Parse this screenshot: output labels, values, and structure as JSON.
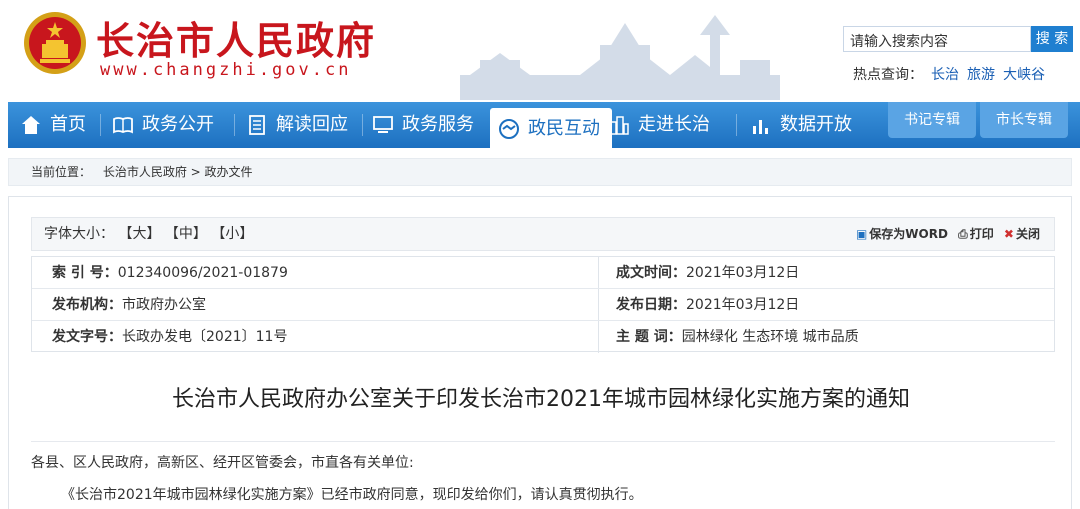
{
  "header": {
    "title": "长治市人民政府",
    "url": "www.changzhi.gov.cn",
    "search_placeholder": "请输入搜索内容",
    "search_button": "搜 索",
    "hot_label": "热点查询：",
    "hot_links": [
      "长治",
      "旅游",
      "大峡谷"
    ]
  },
  "nav": {
    "items": [
      {
        "label": "首页",
        "icon": "home-icon"
      },
      {
        "label": "政务公开",
        "icon": "book-icon"
      },
      {
        "label": "解读回应",
        "icon": "document-icon"
      },
      {
        "label": "政务服务",
        "icon": "monitor-icon"
      },
      {
        "label": "政民互动",
        "icon": "handshake-icon"
      },
      {
        "label": "走进长治",
        "icon": "city-icon"
      },
      {
        "label": "数据开放",
        "icon": "bar-chart-icon"
      }
    ],
    "special": [
      "书记专辑",
      "市长专辑"
    ],
    "accent": "#1d70c0"
  },
  "breadcrumb": {
    "label": "当前位置：",
    "path": "长治市人民政府 > 政办文件"
  },
  "toolbar": {
    "font_label": "字体大小：",
    "sizes": [
      "【大】",
      "【中】",
      "【小】"
    ],
    "save_word": "保存为WORD",
    "print": "打印",
    "close": "关闭"
  },
  "meta": {
    "index_label": "索 引 号：",
    "index_value": "012340096/2021-01879",
    "created_label": "成文时间：",
    "created_value": "2021年03月12日",
    "publisher_label": "发布机构：",
    "publisher_value": "市政府办公室",
    "published_label": "发布日期：",
    "published_value": "2021年03月12日",
    "docno_label": "发文字号：",
    "docno_value": "长政办发电〔2021〕11号",
    "topic_label": "主 题 词：",
    "topic_value": "园林绿化 生态环境 城市品质"
  },
  "document": {
    "title": "长治市人民政府办公室关于印发长治市2021年城市园林绿化实施方案的通知",
    "para1": "各县、区人民政府，高新区、经开区管委会，市直各有关单位:",
    "para2": "《长治市2021年城市园林绿化实施方案》已经市政府同意，现印发给你们，请认真贯彻执行。"
  }
}
